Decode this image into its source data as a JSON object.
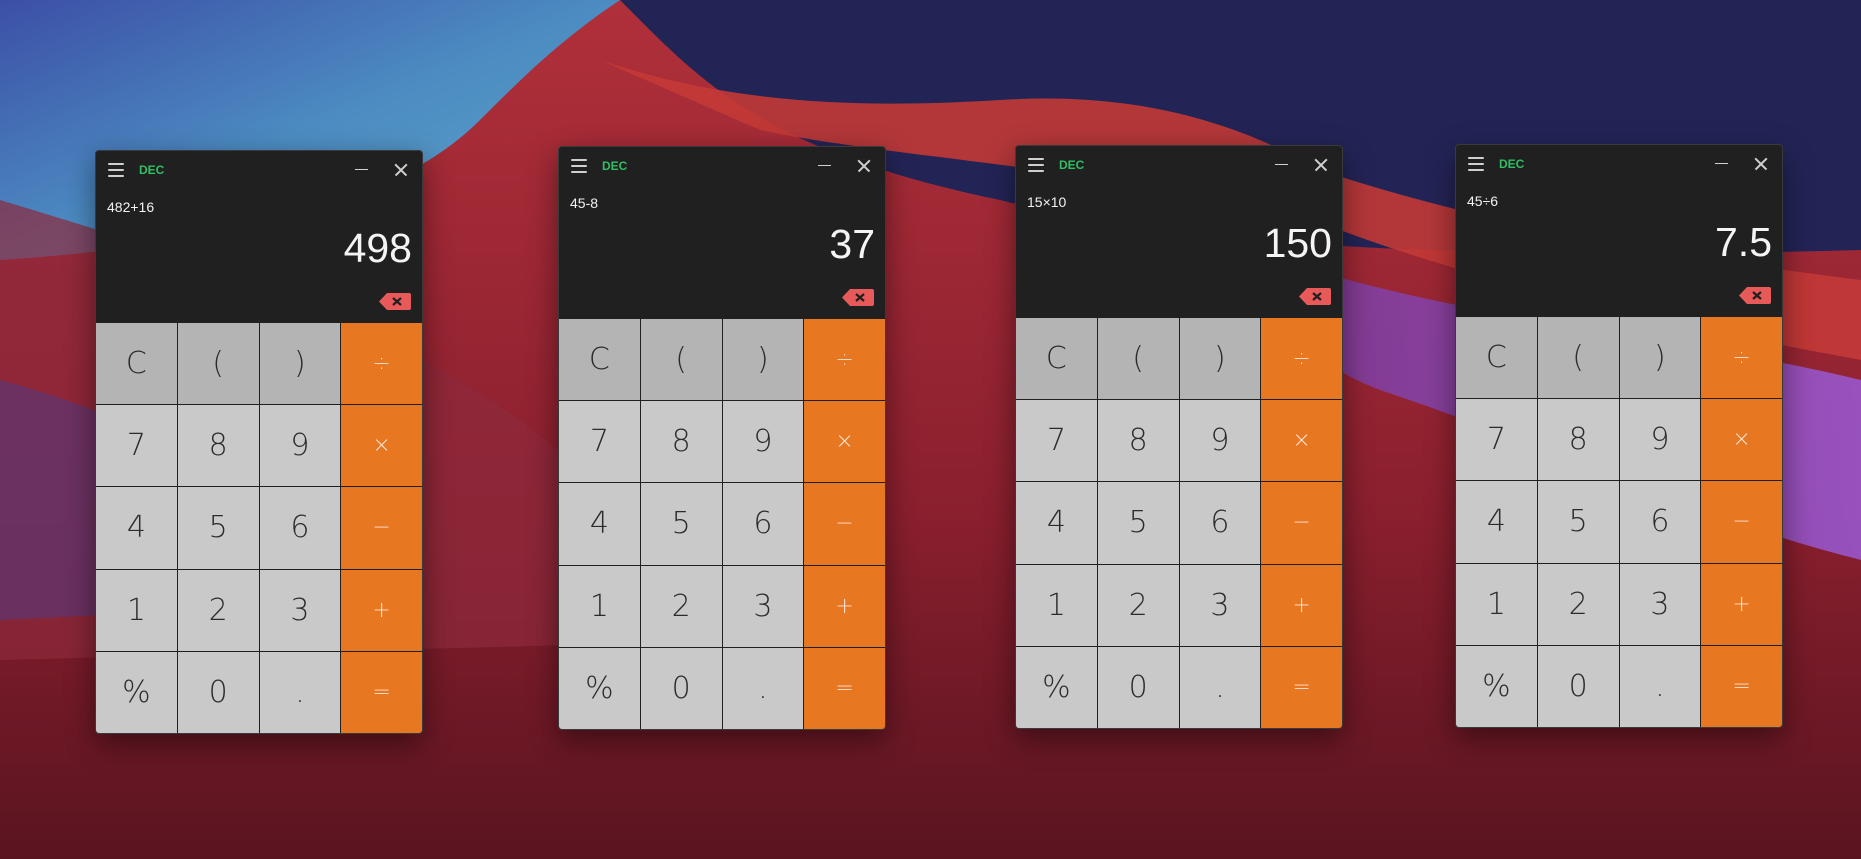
{
  "calculators": [
    {
      "mode": "DEC",
      "expression": "482+16",
      "result": "498"
    },
    {
      "mode": "DEC",
      "expression": "45-8",
      "result": "37"
    },
    {
      "mode": "DEC",
      "expression": "15×10",
      "result": "150"
    },
    {
      "mode": "DEC",
      "expression": "45÷6",
      "result": "7.5"
    }
  ],
  "keys": {
    "clear": "C",
    "paren_open": "(",
    "paren_close": ")",
    "divide": "÷",
    "seven": "7",
    "eight": "8",
    "nine": "9",
    "multiply": "×",
    "four": "4",
    "five": "5",
    "six": "6",
    "minus": "−",
    "one": "1",
    "two": "2",
    "three": "3",
    "plus": "+",
    "percent": "%",
    "zero": "0",
    "decimal": ".",
    "equals": "="
  },
  "colors": {
    "accent": "#e87722",
    "mode_label": "#2fbf62",
    "window_bg": "#202020",
    "key_digit": "#c9c9c9",
    "key_function": "#b4b4b4",
    "backspace": "#e85a5a"
  },
  "icons": {
    "menu": "hamburger-icon",
    "minimize": "minimize-icon",
    "close": "close-icon",
    "backspace": "backspace-icon"
  }
}
